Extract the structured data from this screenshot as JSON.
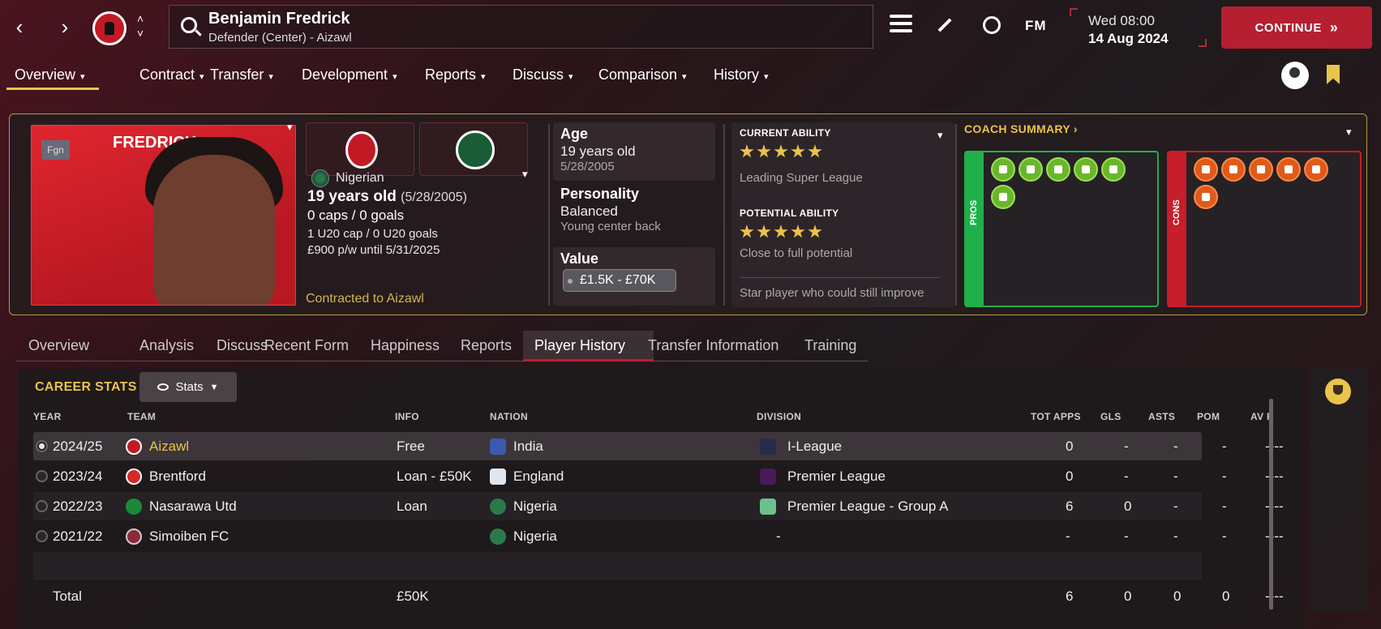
{
  "header": {
    "player_name": "Benjamin Fredrick",
    "player_role": "Defender (Center) - Aizawl",
    "date_day": "Wed 08:00",
    "date_full": "14 Aug 2024",
    "continue_label": "CONTINUE",
    "fm_label": "FM"
  },
  "menu": [
    {
      "label": "Overview"
    },
    {
      "label": "Contract"
    },
    {
      "label": "Transfer"
    },
    {
      "label": "Development"
    },
    {
      "label": "Reports"
    },
    {
      "label": "Discuss"
    },
    {
      "label": "Comparison"
    },
    {
      "label": "History"
    }
  ],
  "profile": {
    "photo_name": "FREDRICK",
    "fgn_badge": "Fgn",
    "nationality": "Nigerian",
    "age_bold": "19 years old",
    "age_dob": "(5/28/2005)",
    "caps": "0 caps / 0 goals",
    "u20": "1 U20 cap / 0 U20 goals",
    "wage": "£900 p/w until 5/31/2025",
    "contracted": "Contracted to Aizawl"
  },
  "stat_cards": {
    "age_label": "Age",
    "age_value": "19 years old",
    "age_dob": "5/28/2005",
    "personality_label": "Personality",
    "personality_value": "Balanced",
    "personality_sub": "Young center back",
    "value_label": "Value",
    "value_range": "£1.5K - £70K"
  },
  "ability": {
    "current_title": "CURRENT ABILITY",
    "current_stars": 5,
    "current_desc": "Leading Super League",
    "potential_title": "POTENTIAL ABILITY",
    "potential_stars": 5,
    "potential_desc": "Close to full potential",
    "summary": "Star player who could still improve"
  },
  "coach": {
    "title": "COACH SUMMARY",
    "pros_label": "PROS",
    "cons_label": "CONS",
    "pros_icons": [
      "star-icon",
      "trend-up-icon",
      "brain-icon",
      "strength-icon",
      "agility-icon",
      "teamwork-icon"
    ],
    "cons_icons": [
      "wrench-icon",
      "clipboard-icon",
      "target-icon",
      "pass-icon",
      "burst-icon",
      "flask-icon"
    ]
  },
  "tabs": [
    {
      "label": "Overview"
    },
    {
      "label": "Analysis"
    },
    {
      "label": "Discuss"
    },
    {
      "label": "Recent Form"
    },
    {
      "label": "Happiness"
    },
    {
      "label": "Reports"
    },
    {
      "label": "Player History"
    },
    {
      "label": "Transfer Information"
    },
    {
      "label": "Training"
    }
  ],
  "career": {
    "title": "CAREER STATS",
    "stats_button": "Stats",
    "columns": {
      "year": "YEAR",
      "team": "TEAM",
      "info": "INFO",
      "nation": "NATION",
      "division": "DIVISION",
      "apps": "TOT APPS",
      "gls": "GLS",
      "asts": "ASTS",
      "pom": "POM",
      "avr": "AV R"
    },
    "rows": [
      {
        "year": "2024/25",
        "team": "Aizawl",
        "info": "Free",
        "nation": "India",
        "division": "I-League",
        "apps": "0",
        "gls": "-",
        "asts": "-",
        "pom": "-",
        "avr": "----"
      },
      {
        "year": "2023/24",
        "team": "Brentford",
        "info": "Loan - £50K",
        "nation": "England",
        "division": "Premier League",
        "apps": "0",
        "gls": "-",
        "asts": "-",
        "pom": "-",
        "avr": "----"
      },
      {
        "year": "2022/23",
        "team": "Nasarawa Utd",
        "info": "Loan",
        "nation": "Nigeria",
        "division": "Premier League - Group A",
        "apps": "6",
        "gls": "0",
        "asts": "-",
        "pom": "-",
        "avr": "----"
      },
      {
        "year": "2021/22",
        "team": "Simoiben FC",
        "info": "",
        "nation": "Nigeria",
        "division": "-",
        "apps": "-",
        "gls": "-",
        "asts": "-",
        "pom": "-",
        "avr": "----"
      }
    ],
    "total": {
      "label": "Total",
      "info": "£50K",
      "apps": "6",
      "gls": "0",
      "asts": "0",
      "pom": "0",
      "avr": "----"
    }
  },
  "colors": {
    "accent_gold": "#e9c34a",
    "brand_red": "#b51f30",
    "pros_green": "#1fb04a",
    "cons_red": "#c81d2a"
  }
}
